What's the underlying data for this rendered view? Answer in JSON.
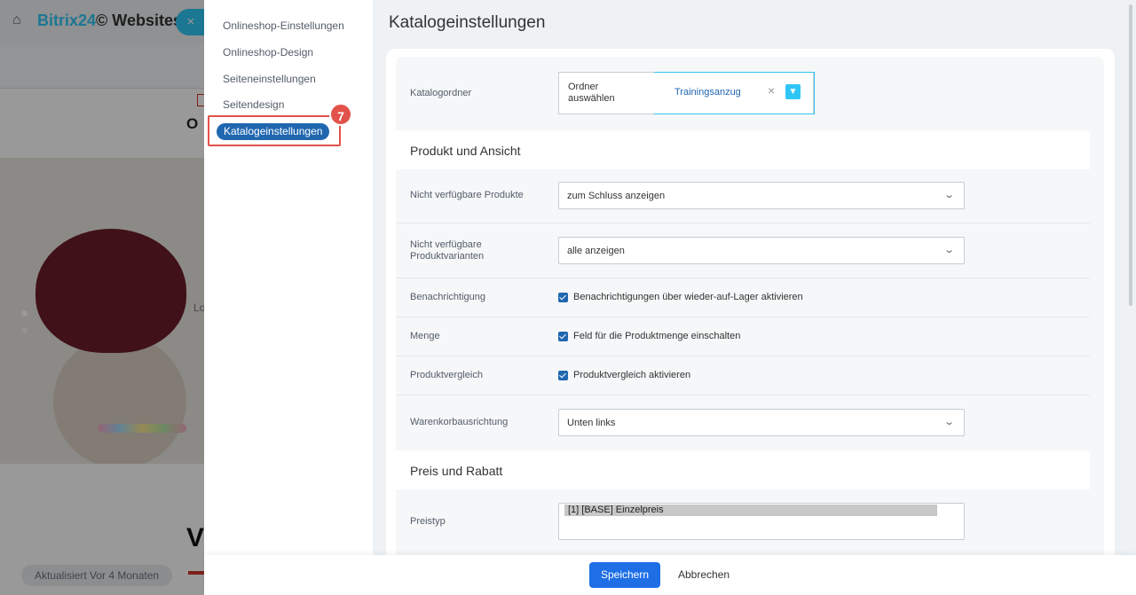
{
  "background": {
    "logo_part1": "Bitrix24",
    "logo_part2": "© Websites",
    "close_glyph": "×",
    "title_fragment": "O",
    "hero_text_fragment": "Lo",
    "big_letter": "V",
    "updated_label": "Aktualisiert Vor 4 Monaten"
  },
  "nav": {
    "items": [
      {
        "label": "Onlineshop-Einstellungen"
      },
      {
        "label": "Onlineshop-Design"
      },
      {
        "label": "Seiteneinstellungen"
      },
      {
        "label": "Seitendesign"
      },
      {
        "label": "Katalogeinstellungen",
        "active": true
      }
    ],
    "step_badge": "7"
  },
  "settings": {
    "title": "Katalogeinstellungen",
    "catalog_folder": {
      "label": "Katalogordner",
      "select_folder": "Ordner auswählen",
      "value": "Trainingsanzug",
      "clear_glyph": "×",
      "dropdown_glyph": "⌄"
    },
    "section_product": "Produkt und Ansicht",
    "unavailable_products": {
      "label": "Nicht verfügbare Produkte",
      "value": "zum Schluss anzeigen"
    },
    "unavailable_variants": {
      "label": "Nicht verfügbare Produktvarianten",
      "value": "alle anzeigen"
    },
    "notification": {
      "label": "Benachrichtigung",
      "checkbox": "Benachrichtigungen über wieder-auf-Lager aktivieren",
      "checked": true
    },
    "quantity": {
      "label": "Menge",
      "checkbox": "Feld für die Produktmenge einschalten",
      "checked": true
    },
    "comparison": {
      "label": "Produktvergleich",
      "checkbox": "Produktvergleich aktivieren",
      "checked": true
    },
    "cart_alignment": {
      "label": "Warenkorbausrichtung",
      "value": "Unten links"
    },
    "section_price": "Preis und Rabatt",
    "price_type": {
      "label": "Preistyp",
      "options": [
        "[1] [BASE] Einzelpreis"
      ]
    },
    "chevron_glyph": "⌄"
  },
  "footer": {
    "save_label": "Speichern",
    "cancel_label": "Abbrechen"
  },
  "colors": {
    "accent": "#2fc6f6",
    "active_nav": "#2067b0",
    "save_button": "#1e6fe6",
    "highlight": "#e2524a"
  }
}
